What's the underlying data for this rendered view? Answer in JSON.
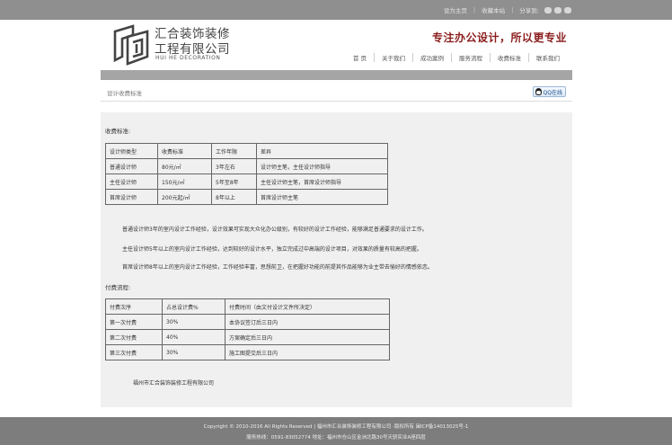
{
  "topbar": {
    "homepage": "设为主页",
    "favorite": "收藏本站",
    "share": "分享到:"
  },
  "logo": {
    "cn_line1": "汇合装饰装修",
    "cn_line2": "工程有限公司",
    "en": "HUI HE DECORATION"
  },
  "slogan": "专注办公设计，所以更专业",
  "nav": [
    "首 页",
    "关于我们",
    "成功案例",
    "服务流程",
    "收费标准",
    "联系我们"
  ],
  "subbar": {
    "title": "设计收费标准",
    "qq": "QQ在线"
  },
  "fees": {
    "label": "收费标准:",
    "headers": [
      "设计师类型",
      "收费标准",
      "工作年限",
      "差异"
    ],
    "rows": [
      [
        "普通设计师",
        "80元/㎡",
        "3年左右",
        "设计师主笔，主任设计师指导"
      ],
      [
        "主任设计师",
        "150元/㎡",
        "5年至8年",
        "主任设计师主笔，首席设计师指导"
      ],
      [
        "首席设计师",
        "200元起/㎡",
        "8年以上",
        "首席设计师主笔"
      ]
    ]
  },
  "paragraphs": [
    "普通设计师3年的室内设计工作经验，设计效果可实现大众化办公级别，有较好的设计工作经验，能够满足普通要求的设计工作。",
    "主任设计师5年以上的室内设计工作经验，达到较好的设计水平，独立完成过中高端的设计项目，对效果的质量有较高的把握。",
    "首席设计师8年以上的室内设计工作经验，工作经验丰富，思想前卫，在把握好功能的前提其作品能够为业主带去愉好的情感依恋。"
  ],
  "payment": {
    "label": "付费流程:",
    "headers": [
      "付费次序",
      "占总设计费%",
      "付费时间（由文付设计文件所决定）"
    ],
    "rows": [
      [
        "第一次付费",
        "30%",
        "本协议签订后三日内"
      ],
      [
        "第二次付费",
        "40%",
        "方案确定后三日内"
      ],
      [
        "第三次付费",
        "30%",
        "施工图提交后三日内"
      ]
    ]
  },
  "company": "福州市汇合装饰装修工程有限公司",
  "footer": {
    "line1": "Copyright © 2010-2016 All Rights Reserved | 福州市汇合装饰装修工程有限公司 ·版权所有 闽ICP备14013025号-1",
    "line2": "服务热线：0591-83052774 地址：福州市仓山区金洲北路30号天骄实业A座四层"
  }
}
